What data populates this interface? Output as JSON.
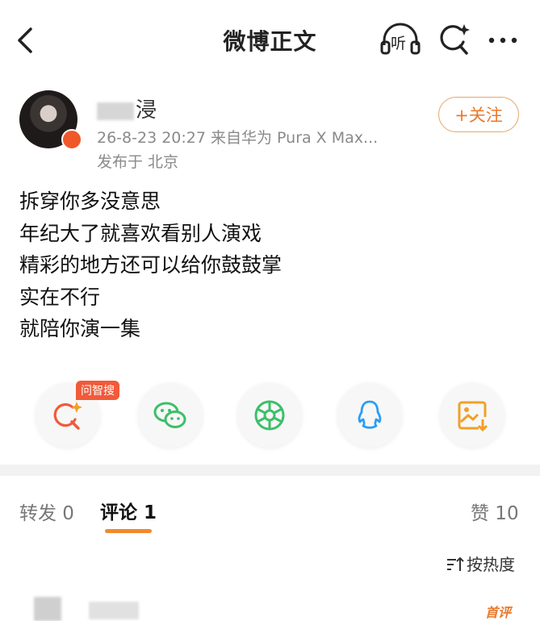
{
  "header": {
    "title": "微博正文",
    "listen_label": "听",
    "icons": [
      "back-arrow-icon",
      "headphones-listen-icon",
      "ai-search-icon",
      "more-dots-icon"
    ]
  },
  "author": {
    "name": "浸",
    "time_source": "26-8-23 20:27  来自华为 Pura X Max...",
    "location": "发布于 北京",
    "follow_label": "+关注"
  },
  "post": {
    "lines": [
      "拆穿你多没意思",
      "年纪大了就喜欢看别人演戏",
      "精彩的地方还可以给你鼓鼓掌",
      "实在不行",
      "就陪你演一集"
    ]
  },
  "share": {
    "tag": "问智搜",
    "icons": [
      "ai-search-icon",
      "wechat-icon",
      "moments-icon",
      "qq-icon",
      "save-image-icon"
    ],
    "colors": {
      "search": "#f05a3a",
      "wechat": "#3cbf6a",
      "moments": "#3cbf6a",
      "qq": "#2a9df4",
      "save": "#f0a028"
    }
  },
  "tabs": {
    "repost": "转发 0",
    "comments": "评论 1",
    "likes": "赞 10",
    "sort": "按热度"
  },
  "comment": {
    "badge": "首评"
  },
  "accent": "#f08a2c"
}
